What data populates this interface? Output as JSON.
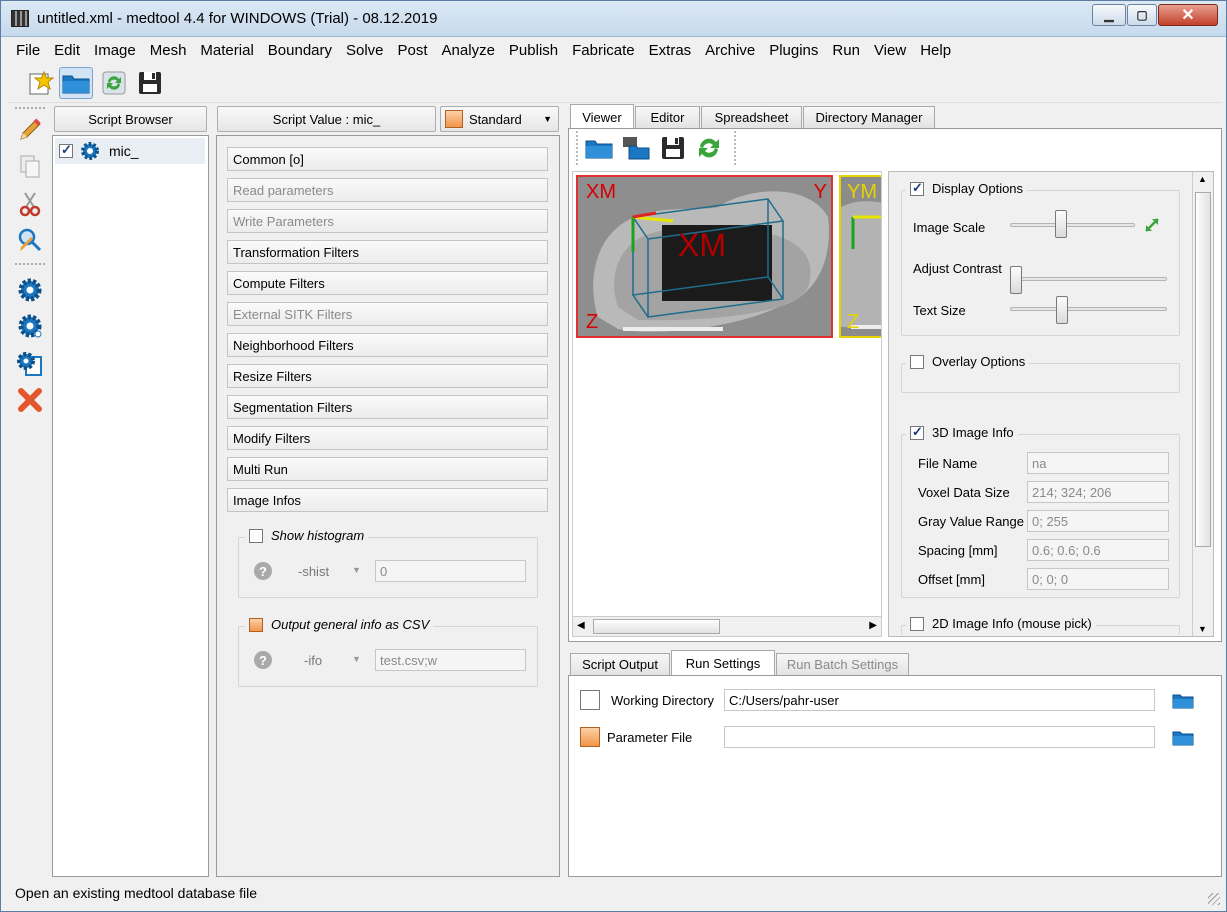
{
  "window": {
    "title": "untitled.xml - medtool 4.4 for WINDOWS (Trial) - 08.12.2019"
  },
  "menu": [
    "File",
    "Edit",
    "Image",
    "Mesh",
    "Material",
    "Boundary",
    "Solve",
    "Post",
    "Analyze",
    "Publish",
    "Fabricate",
    "Extras",
    "Archive",
    "Plugins",
    "Run",
    "View",
    "Help"
  ],
  "left_panel": {
    "header": "Script Browser",
    "items": [
      {
        "label": "mic_",
        "checked": true
      }
    ]
  },
  "middle_panel": {
    "header": "Script Value : mic_",
    "mode_select": "Standard",
    "filters": [
      {
        "label": "Common   [o]",
        "enabled": true
      },
      {
        "label": "Read parameters",
        "enabled": false
      },
      {
        "label": "Write Parameters",
        "enabled": false
      },
      {
        "label": "Transformation Filters",
        "enabled": true
      },
      {
        "label": "Compute Filters",
        "enabled": true
      },
      {
        "label": "External SITK Filters",
        "enabled": false
      },
      {
        "label": "Neighborhood Filters",
        "enabled": true
      },
      {
        "label": "Resize Filters",
        "enabled": true
      },
      {
        "label": "Segmentation Filters",
        "enabled": true
      },
      {
        "label": "Modify Filters",
        "enabled": true
      },
      {
        "label": "Multi Run",
        "enabled": true
      },
      {
        "label": "Image Infos",
        "enabled": true
      }
    ],
    "histogram": {
      "label": "Show histogram",
      "flag": "-shist",
      "value": "0"
    },
    "csv": {
      "label": "Output general info as CSV",
      "flag": "-ifo",
      "value": "test.csv;w"
    }
  },
  "viewer_tabs": [
    "Viewer",
    "Editor",
    "Spreadsheet",
    "Directory Manager"
  ],
  "viewer": {
    "view1": {
      "top_left": "XM",
      "top_right": "Y",
      "bottom_left": "Z",
      "center": "XM"
    },
    "view2": {
      "top_left": "YM",
      "bottom_left": "Z"
    }
  },
  "options": {
    "display": {
      "label": "Display Options",
      "checked": true,
      "image_scale_label": "Image Scale",
      "adjust_contrast_label": "Adjust Contrast",
      "text_size_label": "Text Size",
      "image_scale": 0.4,
      "adjust_contrast": 0.0,
      "text_size": 0.32
    },
    "overlay": {
      "label": "Overlay Options",
      "checked": false
    },
    "info3d": {
      "label": "3D Image Info",
      "checked": true,
      "rows": [
        {
          "key": "File Name",
          "value": "na"
        },
        {
          "key": "Voxel Data Size",
          "value": "214; 324; 206"
        },
        {
          "key": "Gray Value Range",
          "value": "0; 255"
        },
        {
          "key": "Spacing  [mm]",
          "value": "0.6; 0.6; 0.6"
        },
        {
          "key": "Offset  [mm]",
          "value": "0; 0; 0"
        }
      ]
    },
    "info2d": {
      "label": "2D Image Info (mouse pick)",
      "checked": false
    }
  },
  "bottom_tabs": [
    "Script Output",
    "Run Settings",
    "Run Batch Settings"
  ],
  "run_settings": {
    "working_directory_label": "Working Directory",
    "working_directory": "C:/Users/pahr-user",
    "parameter_file_label": "Parameter File",
    "parameter_file": ""
  },
  "status": "Open an existing medtool database file",
  "colors": {
    "accent": "#1c77c3",
    "view1_border": "#e03030",
    "view2_border": "#e6d400"
  }
}
